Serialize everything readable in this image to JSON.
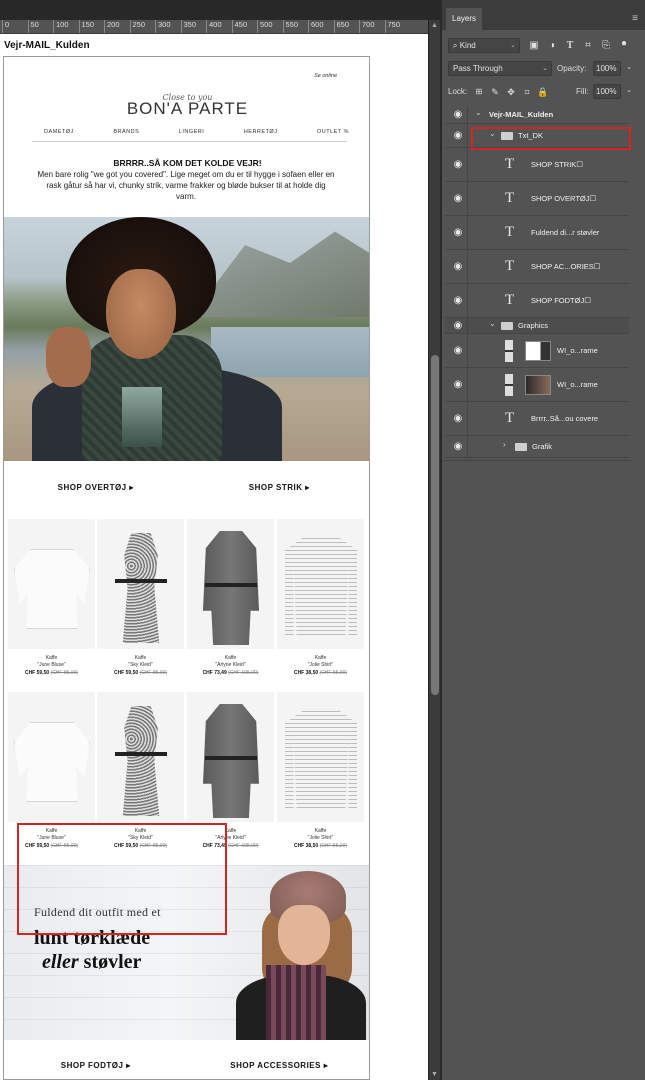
{
  "document": {
    "title": "Vejr-MAIL_Kulden",
    "ruler_ticks": [
      "0",
      "50",
      "100",
      "150",
      "200",
      "250",
      "300",
      "350",
      "400",
      "450",
      "500",
      "550",
      "600",
      "650",
      "700",
      "750"
    ]
  },
  "email": {
    "se_online": "Se online",
    "logo_script": "Close to you",
    "logo": "BON'A PARTE",
    "nav": [
      "DAMETØJ",
      "BRANDS",
      "LINGERI",
      "HERRETØJ",
      "OUTLET %"
    ],
    "headline": "BRRRR..SÅ KOM DET KOLDE VEJR!",
    "intro": "Men bare rolig \"we got you covered\". Lige meget om du er til hygge i sofaen eller en rask gåtur så har vi, chunky strik, varme frakker og bløde bukser til at holde dig varm.",
    "shop_row_1": [
      "SHOP OVERTØJ ▸",
      "SHOP STRIK ▸"
    ],
    "products_row_1": [
      {
        "brand": "Kaffe",
        "name": "\"June Bluse\"",
        "price": "CHF 59,50",
        "old_price": "(CHF 85,00)",
        "garment": "blouse"
      },
      {
        "brand": "Kaffe",
        "name": "\"Sky Kleid\"",
        "price": "CHF 59,50",
        "old_price": "(CHF 85,00)",
        "garment": "dress"
      },
      {
        "brand": "Kaffe",
        "name": "\"Arlyne Kleid\"",
        "price": "CHF 73,49",
        "old_price": "(CHF 105,00)",
        "garment": "shirtdress"
      },
      {
        "brand": "Kaffe",
        "name": "\"Jolie Shirt\"",
        "price": "CHF 38,50",
        "old_price": "(CHF 55,00)",
        "garment": "stripe"
      }
    ],
    "products_row_2": [
      {
        "brand": "Kaffe",
        "name": "\"June Bluse\"",
        "price": "CHF 59,50",
        "old_price": "(CHF 85,00)",
        "garment": "blouse"
      },
      {
        "brand": "Kaffe",
        "name": "\"Sky Kleid\"",
        "price": "CHF 59,50",
        "old_price": "(CHF 85,00)",
        "garment": "dress"
      },
      {
        "brand": "Kaffe",
        "name": "\"Arlyne Kleid\"",
        "price": "CHF 73,49",
        "old_price": "(CHF 105,00)",
        "garment": "shirtdress"
      },
      {
        "brand": "Kaffe",
        "name": "\"Jolie Shirt\"",
        "price": "CHF 38,50",
        "old_price": "(CHF 55,00)",
        "garment": "stripe"
      }
    ],
    "promo": {
      "line1": "Fuldend dit outfit med et",
      "line2": "lunt tørklæde",
      "line3_italic": "eller",
      "line3_rest": " støvler"
    },
    "shop_row_2": [
      "SHOP FODTØJ ▸",
      "SHOP ACCESSORIES ▸"
    ]
  },
  "panel": {
    "tab": "Layers",
    "filter_kind": "Kind",
    "blend_mode": "Pass Through",
    "opacity_label": "Opacity:",
    "opacity_value": "100%",
    "lock_label": "Lock:",
    "fill_label": "Fill:",
    "fill_value": "100%",
    "layers": [
      {
        "name": "Vejr-MAIL_Kulden",
        "kind": "doc",
        "indent": 0,
        "expanded": true
      },
      {
        "name": "Txt_DK",
        "kind": "group",
        "indent": 1,
        "expanded": true,
        "selected": true
      },
      {
        "name": "SHOP STRIK☐",
        "kind": "text",
        "indent": 2
      },
      {
        "name": "SHOP OVERTØJ☐",
        "kind": "text",
        "indent": 2
      },
      {
        "name": "Fuldend di...r støvler",
        "kind": "text",
        "indent": 2
      },
      {
        "name": "SHOP AC...ORIES☐",
        "kind": "text",
        "indent": 2
      },
      {
        "name": "SHOP FODTØJ☐",
        "kind": "text",
        "indent": 2
      },
      {
        "name": "Graphics",
        "kind": "group",
        "indent": 1,
        "expanded": true
      },
      {
        "name": "WI_o...rame",
        "kind": "smart",
        "indent": 2
      },
      {
        "name": "WI_o...rame",
        "kind": "smart",
        "indent": 2
      },
      {
        "name": "Brrrr..Så...ou covere",
        "kind": "text",
        "indent": 2
      },
      {
        "name": "Grafik",
        "kind": "group",
        "indent": 2,
        "expanded": false
      }
    ],
    "swatches": [
      "#ffffff",
      "#e02020",
      "#f0f0f0",
      "#9b59b6",
      "#c39bd3",
      "#1f3c88",
      "#2e4fa8",
      "#4a6fbf",
      "#c0782a",
      "#7a4a2a"
    ]
  },
  "colors": {
    "highlight": "#d42424",
    "ps_panel": "#535353",
    "ps_dark": "#282828"
  }
}
